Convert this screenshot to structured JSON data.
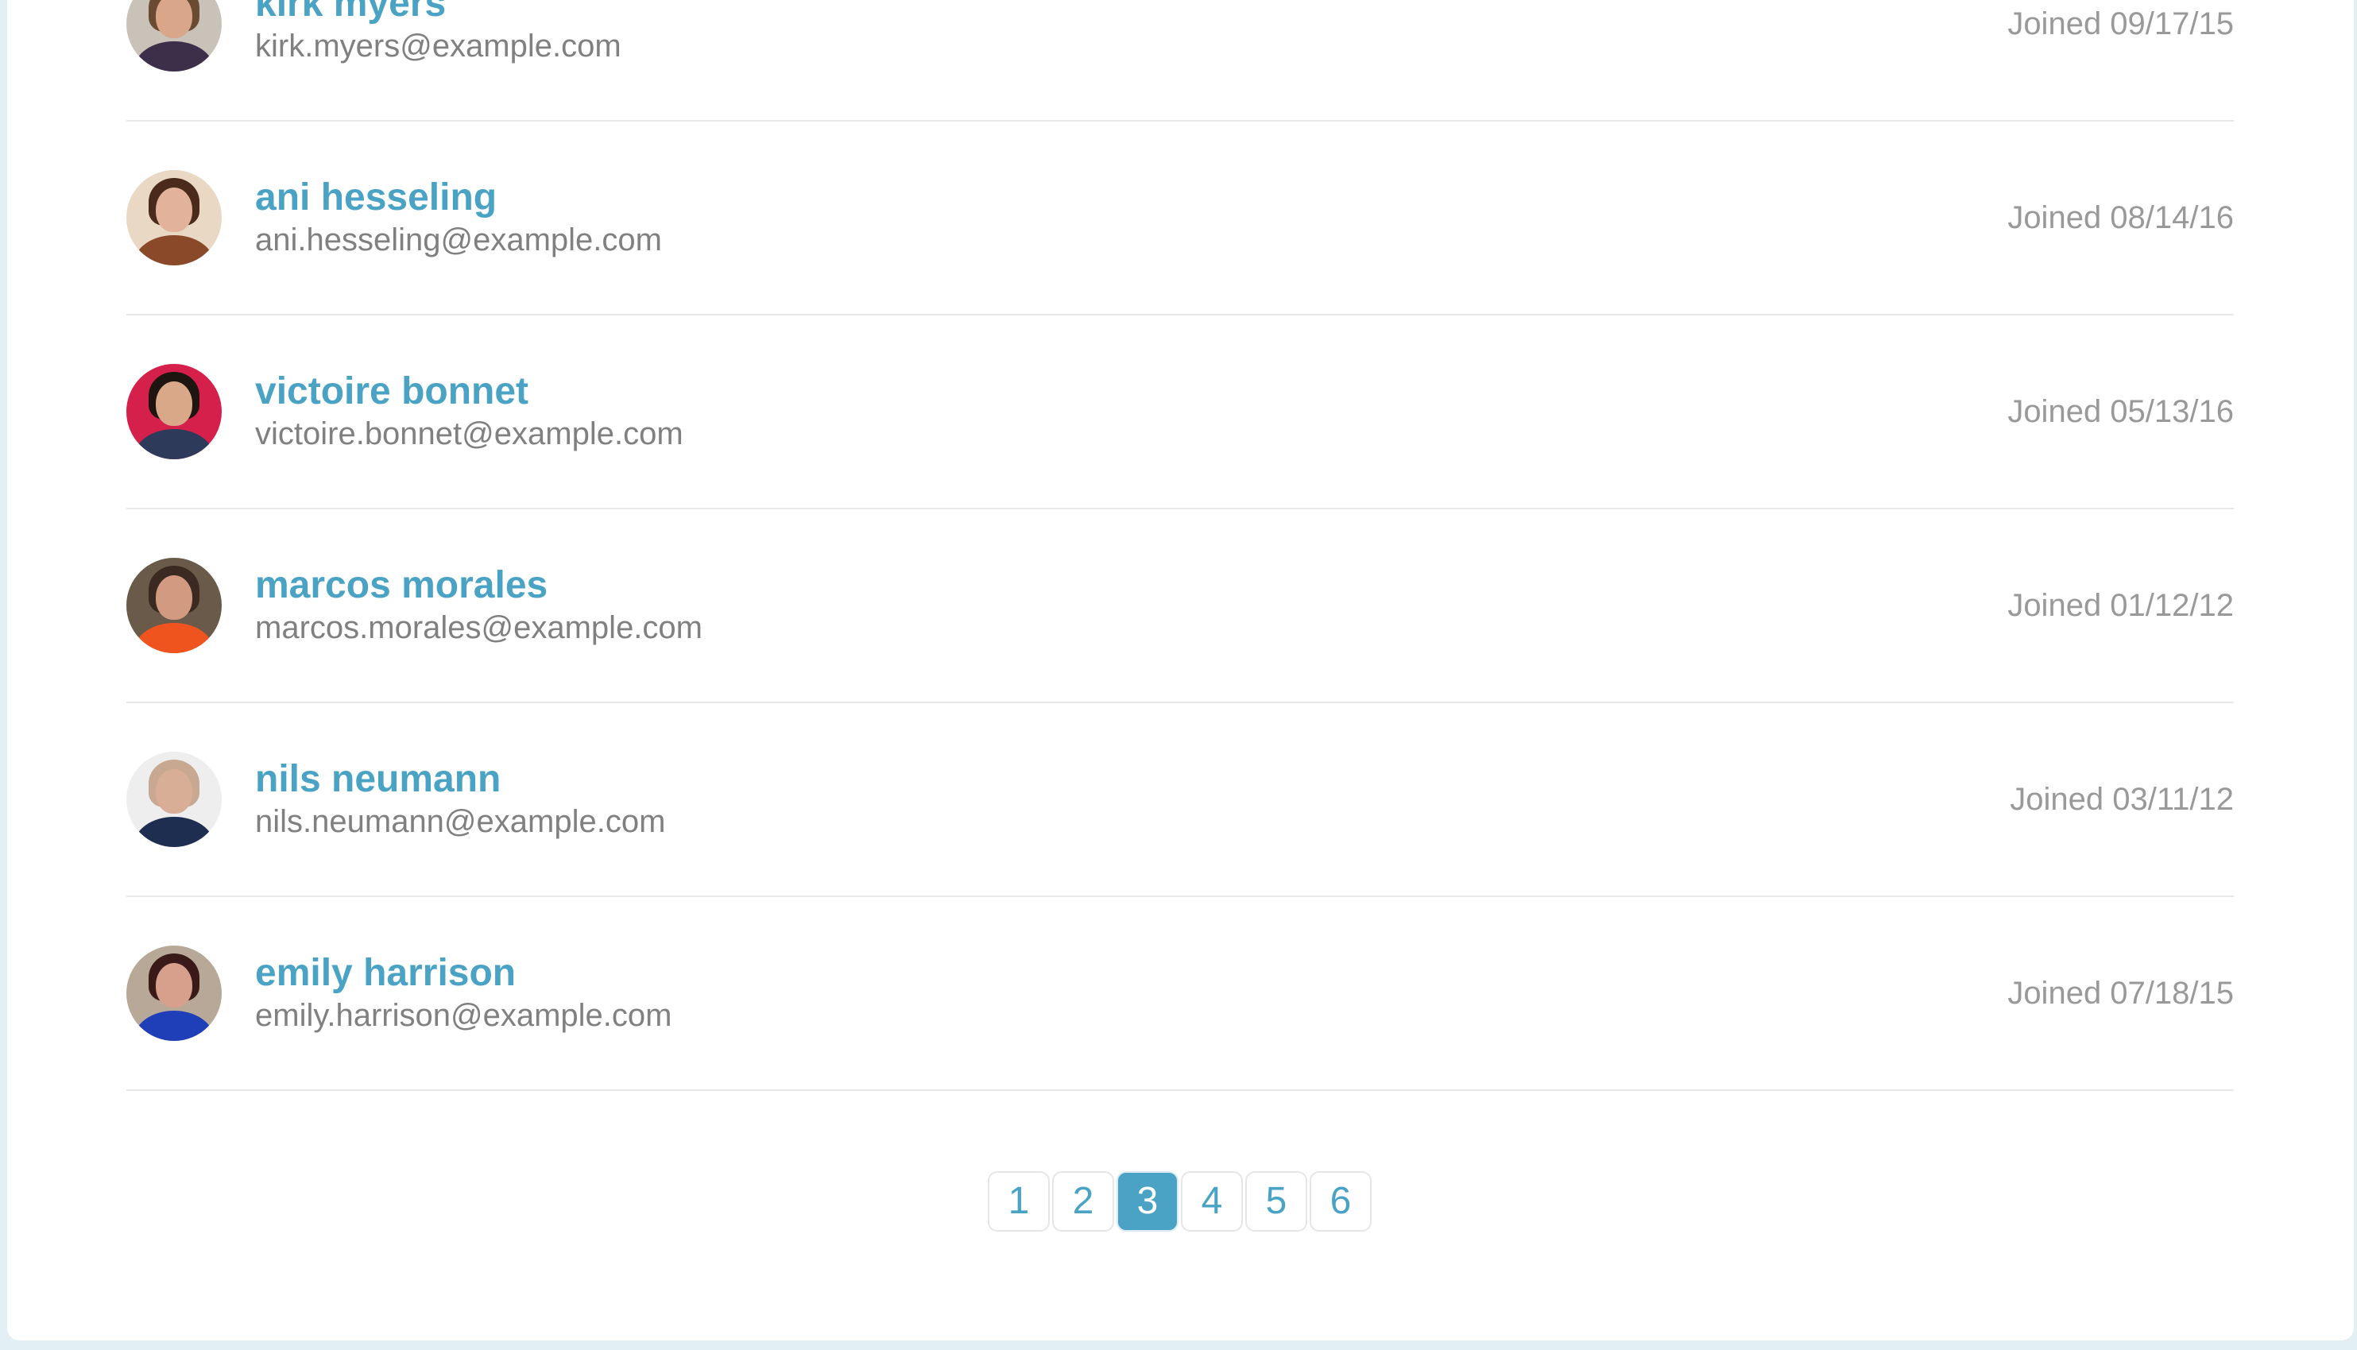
{
  "accent_color": "#4aa3c4",
  "users": [
    {
      "name": "kirk myers",
      "email": "kirk.myers@example.com",
      "joined": "Joined 09/17/15",
      "avatar": {
        "bg": "#c9c2b8",
        "skin": "#d9a68a",
        "hair": "#6b4a32",
        "shirt": "#3b2f4a"
      }
    },
    {
      "name": "ani hesseling",
      "email": "ani.hesseling@example.com",
      "joined": "Joined 08/14/16",
      "avatar": {
        "bg": "#e8d8c4",
        "skin": "#e2b39a",
        "hair": "#4a2a1a",
        "shirt": "#8a4a2a"
      }
    },
    {
      "name": "victoire bonnet",
      "email": "victoire.bonnet@example.com",
      "joined": "Joined 05/13/16",
      "avatar": {
        "bg": "#d4204a",
        "skin": "#d8a888",
        "hair": "#1e1410",
        "shirt": "#2e3a5a"
      }
    },
    {
      "name": "marcos morales",
      "email": "marcos.morales@example.com",
      "joined": "Joined 01/12/12",
      "avatar": {
        "bg": "#6a5a4a",
        "skin": "#d29a80",
        "hair": "#3a2a22",
        "shirt": "#f0541e"
      }
    },
    {
      "name": "nils neumann",
      "email": "nils.neumann@example.com",
      "joined": "Joined 03/11/12",
      "avatar": {
        "bg": "#eeeeee",
        "skin": "#d8ae96",
        "hair": "#c8a890",
        "shirt": "#1e2e50"
      }
    },
    {
      "name": "emily harrison",
      "email": "emily.harrison@example.com",
      "joined": "Joined 07/18/15",
      "avatar": {
        "bg": "#b8a898",
        "skin": "#d6a08c",
        "hair": "#3a1a18",
        "shirt": "#1f3fb8"
      }
    }
  ],
  "pagination": {
    "pages": [
      "1",
      "2",
      "3",
      "4",
      "5",
      "6"
    ],
    "current": "3"
  }
}
